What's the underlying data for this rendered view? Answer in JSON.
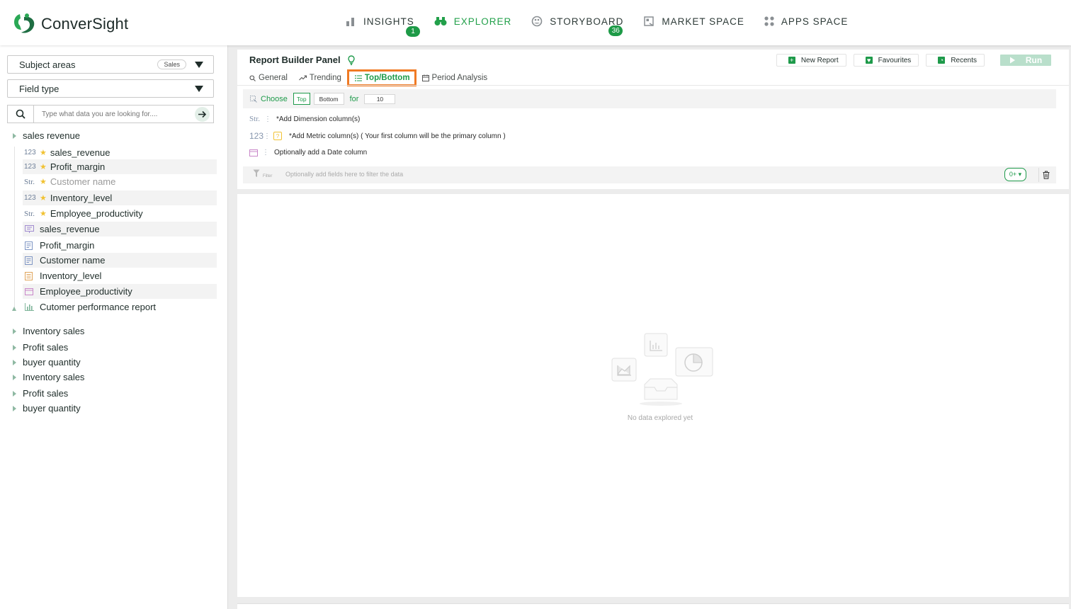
{
  "header": {
    "brand": "ConverSight",
    "nav": [
      {
        "label": "INSIGHTS",
        "icon": "bar-chart-icon",
        "badge": "1"
      },
      {
        "label": "EXPLORER",
        "icon": "binoculars-icon",
        "badge": ""
      },
      {
        "label": "STORYBOARD",
        "icon": "palette-icon",
        "badge": "36"
      },
      {
        "label": "MARKET SPACE",
        "icon": "marketplace-icon",
        "badge": ""
      },
      {
        "label": "APPS SPACE",
        "icon": "grid-icon",
        "badge": ""
      }
    ],
    "active": "EXPLORER",
    "accent_color": "#22a04a"
  },
  "sidebar": {
    "subject_areas_label": "Subject areas",
    "subject_areas_tag": "Sales",
    "field_type_label": "Field type",
    "search_placeholder": "Type what data you are looking for....",
    "tree_root": "sales revenue",
    "fields": [
      {
        "type": "123",
        "starred": true,
        "label": "sales_revenue"
      },
      {
        "type": "123",
        "starred": true,
        "label": "Profit_margin"
      },
      {
        "type": "Str.",
        "starred": true,
        "label": "Customer name"
      },
      {
        "type": "123",
        "starred": true,
        "label": "Inventory_level"
      },
      {
        "type": "Str.",
        "starred": true,
        "label": "Employee_productivity"
      },
      {
        "type": "report-icon",
        "starred": false,
        "label": "sales_revenue"
      },
      {
        "type": "table-icon",
        "starred": false,
        "label": "Profit_margin"
      },
      {
        "type": "table-icon",
        "starred": false,
        "label": "Customer name"
      },
      {
        "type": "document-icon",
        "starred": false,
        "label": "Inventory_level"
      },
      {
        "type": "calendar-icon",
        "starred": false,
        "label": "Employee_productivity"
      },
      {
        "type": "chart-icon",
        "starred": false,
        "label": "Cutomer performance report"
      }
    ],
    "other_groups": [
      "Inventory sales",
      "Profit sales",
      "buyer quantity",
      "Inventory sales",
      "Profit sales",
      "buyer quantity"
    ]
  },
  "panel": {
    "title": "Report Builder Panel",
    "actions": {
      "new_report": "New Report",
      "favourites": "Favourites",
      "recents": "Recents",
      "run": "Run"
    },
    "tabs": [
      "General",
      "Trending",
      "Top/Bottom",
      "Period Analysis"
    ],
    "active_tab": "Top/Bottom",
    "choose": {
      "label": "Choose",
      "top": "Top",
      "bottom": "Bottom",
      "for_label": "for",
      "count": "10"
    },
    "rows": {
      "dimension_type": "Str.",
      "dimension_text": "*Add Dimension column(s)",
      "metric_type": "123",
      "metric_text": "*Add Metric column(s) ( Your first column will be the primary column )",
      "date_text": "Optionally add a Date column"
    },
    "filter": {
      "label": "Filter",
      "placeholder": "Optionally add fields here to filter the data",
      "count": "0+ ▾"
    }
  },
  "canvas": {
    "empty_text": "No data explored yet"
  }
}
